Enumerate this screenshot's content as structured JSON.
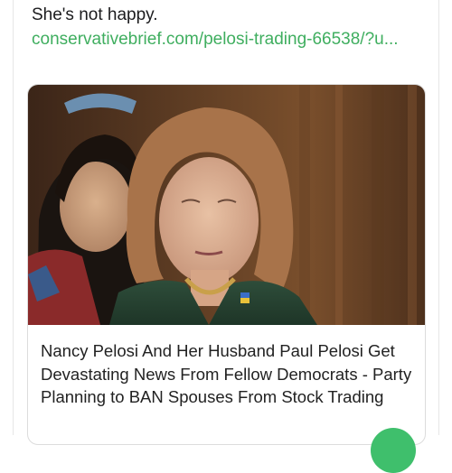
{
  "post": {
    "text": "She's not happy.",
    "link": "conservativebrief.com/pelosi-trading-66538/?u..."
  },
  "card": {
    "image_alt": "photo-of-woman-in-green-jacket",
    "title": "Nancy Pelosi And Her Husband Paul Pelosi Get Devastating News From Fellow Democrats - Party Planning to BAN Spouses From Stock Trading"
  },
  "colors": {
    "link": "#3fae5f",
    "fab": "#3fbf6c"
  }
}
